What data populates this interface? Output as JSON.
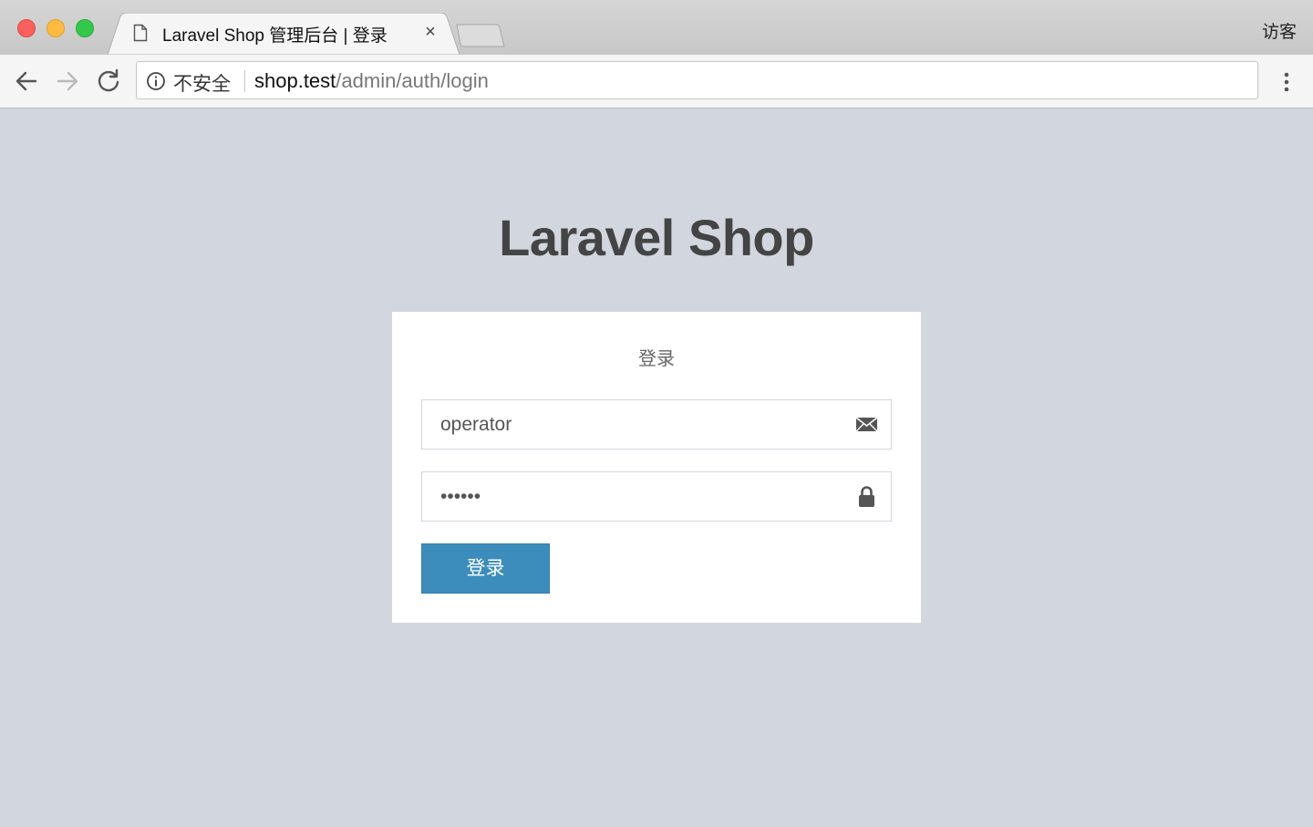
{
  "browser": {
    "tab_title": "Laravel Shop 管理后台 | 登录",
    "tab_close": "×",
    "profile_label": "访客",
    "security_label": "不安全",
    "url_host": "shop.test",
    "url_path": "/admin/auth/login"
  },
  "page": {
    "logo": "Laravel Shop",
    "login_message": "登录",
    "username_value": "operator",
    "password_value": "••••••",
    "submit_label": "登录",
    "accent_color": "#3c8dbc"
  },
  "icons": {
    "email": "envelope-icon",
    "password": "lock-icon"
  }
}
